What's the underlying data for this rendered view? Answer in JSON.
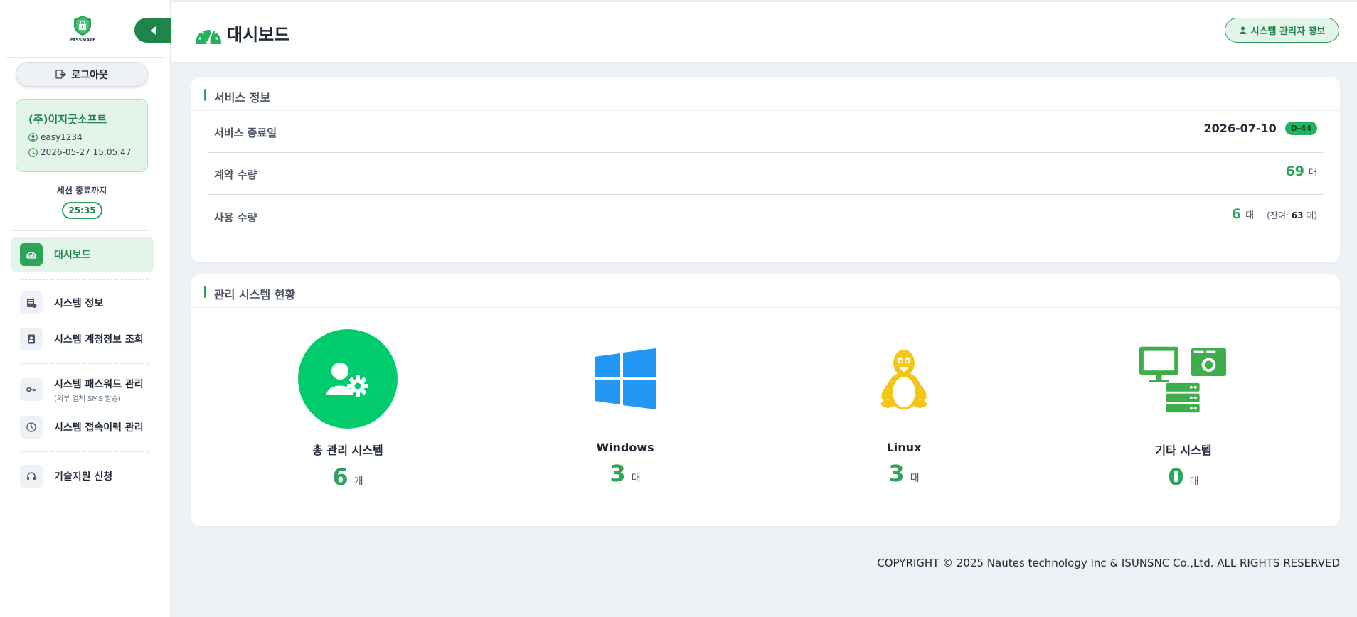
{
  "brand": {
    "logo_text": "PASSMATE"
  },
  "sidebar": {
    "logout_label": "로그아웃",
    "user": {
      "company": "(주)이지굿소프트",
      "user_id": "easy1234",
      "login_time": "2026-05-27 15:05:47"
    },
    "session": {
      "label": "세션 종료까지",
      "timer": "25:35"
    },
    "items": [
      {
        "label": "대시보드",
        "icon": "dashboard-icon",
        "active": true
      },
      {
        "label": "시스템 정보",
        "icon": "server-icon"
      },
      {
        "label": "시스템 계정정보 조회",
        "icon": "id-card-icon"
      },
      {
        "label": "시스템 패스워드 관리",
        "sub": "(외부 업체 SMS 발송)",
        "icon": "key-icon"
      },
      {
        "label": "시스템 접속이력 관리",
        "icon": "clock-icon"
      },
      {
        "label": "기술지원 신청",
        "icon": "headset-icon"
      }
    ]
  },
  "header": {
    "title": "대시보드",
    "admin_button": "시스템 관리자 정보"
  },
  "service_info": {
    "title": "서비스 정보",
    "rows": [
      {
        "label": "서비스 종료일",
        "date": "2026-07-10",
        "badge": "D-44"
      },
      {
        "label": "계약 수량",
        "value": "69",
        "unit": "대"
      },
      {
        "label": "사용 수량",
        "value": "6",
        "unit": "대",
        "remain_prefix": "(잔여: ",
        "remain_value": "63",
        "remain_suffix": " 대)"
      }
    ]
  },
  "system_status": {
    "title": "관리 시스템 현황",
    "items": [
      {
        "label": "총 관리 시스템",
        "count": "6",
        "unit": "개",
        "icon": "user-gear-icon"
      },
      {
        "label": "Windows",
        "count": "3",
        "unit": "대",
        "icon": "windows-icon"
      },
      {
        "label": "Linux",
        "count": "3",
        "unit": "대",
        "icon": "linux-icon"
      },
      {
        "label": "기타 시스템",
        "count": "0",
        "unit": "대",
        "icon": "other-systems-icon"
      }
    ]
  },
  "footer": {
    "copyright": "COPYRIGHT © 2025 Nautes technology Inc & ISUNSNC Co.,Ltd. ALL RIGHTS RESERVED"
  },
  "colors": {
    "primary": "#2ea35a",
    "dark_green": "#1e8449",
    "windows_blue": "#2196f3",
    "linux_yellow": "#f5c518",
    "background": "#eef2f7"
  }
}
